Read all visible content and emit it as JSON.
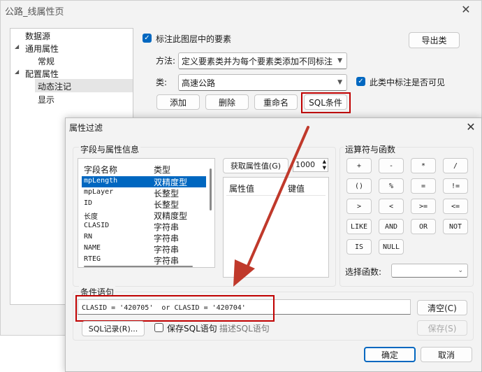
{
  "main_window": {
    "title": "公路_线属性页",
    "tree": [
      {
        "label": "数据源",
        "expander": ""
      },
      {
        "label": "通用属性",
        "expander": "◢"
      },
      {
        "label": "常规",
        "expander": ""
      },
      {
        "label": "配置属性",
        "expander": "◢"
      },
      {
        "label": "动态注记",
        "expander": ""
      },
      {
        "label": "显示",
        "expander": ""
      }
    ],
    "label_features_check": "标注此图层中的要素",
    "export_class_button": "导出类",
    "method_label": "方法:",
    "method_value": "定义要素类并为每个要素类添加不同标注",
    "class_label": "类:",
    "class_value": "高速公路",
    "class_visible_check": "此类中标注是否可见",
    "buttons": {
      "add": "添加",
      "delete": "删除",
      "rename": "重命名",
      "sql": "SQL条件"
    }
  },
  "dialog": {
    "title": "属性过滤",
    "fields_group_title": "字段与属性信息",
    "fields_headers": [
      "字段名称",
      "类型"
    ],
    "fields": [
      {
        "name": "mpLength",
        "type": "双精度型"
      },
      {
        "name": "mpLayer",
        "type": "长整型"
      },
      {
        "name": "ID",
        "type": "长整型"
      },
      {
        "name": "长度",
        "type": "双精度型"
      },
      {
        "name": "CLASID",
        "type": "字符串"
      },
      {
        "name": "RN",
        "type": "字符串"
      },
      {
        "name": "NAME",
        "type": "字符串"
      },
      {
        "name": "RTEG",
        "type": "字符串"
      }
    ],
    "get_values_button": "获取属性值(G)",
    "count_value": "1000",
    "values_headers": [
      "属性值",
      "键值"
    ],
    "operators_group_title": "运算符与函数",
    "operators": [
      "+",
      "-",
      "*",
      "/",
      "()",
      "%",
      "=",
      "!=",
      ">",
      "<",
      ">=",
      "<=",
      "LIKE",
      "AND",
      "OR",
      "NOT",
      "IS",
      "NULL"
    ],
    "select_function_label": "选择函数:",
    "select_function_value": "",
    "condition_group_title": "条件语句",
    "condition_text": "CLASID = '420705'  or CLASID = '420704'",
    "clear_button": "清空(C)",
    "sql_log_button": "SQL记录(R)...",
    "save_sql_check": "保存SQL语句",
    "describe_sql_placeholder": "描述SQL语句",
    "save_button": "保存(S)",
    "ok_button": "确定",
    "cancel_button": "取消"
  },
  "colors": {
    "accent": "#0067c0",
    "highlight_red": "#c00000",
    "arrow": "#c0392b"
  }
}
